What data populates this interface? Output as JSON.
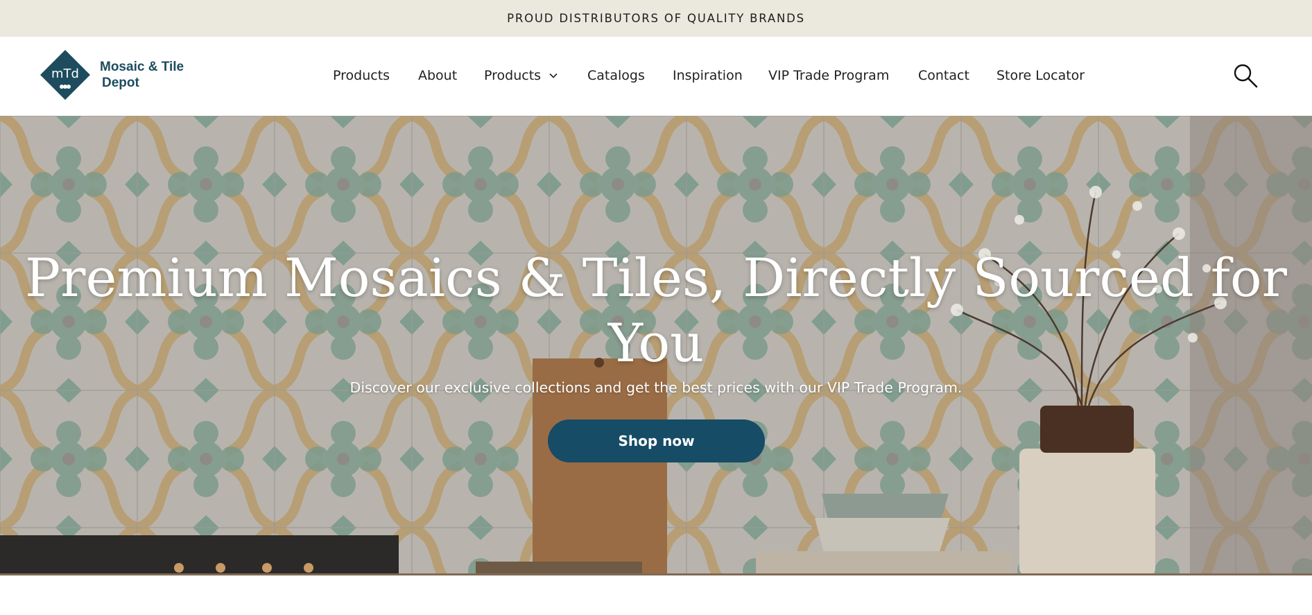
{
  "announcement": {
    "text": "PROUD DISTRIBUTORS OF QUALITY BRANDS"
  },
  "brand": {
    "name_line1": "Mosaic & Tile",
    "name_line2": "Depot",
    "mark_letters": "mTd",
    "color": "#1d4c5e"
  },
  "nav": {
    "items": [
      {
        "label": "Products"
      },
      {
        "label": "About"
      },
      {
        "label": "Products",
        "icon": "chevron-down-icon"
      },
      {
        "label": "Catalogs"
      },
      {
        "label": "Inspiration"
      },
      {
        "label": "VIP Trade Program"
      },
      {
        "label": "Contact"
      },
      {
        "label": "Store Locator"
      }
    ],
    "search_icon": "search-icon"
  },
  "hero": {
    "title": "Premium Mosaics & Tiles, Directly Sourced for You",
    "subtitle": "Discover our exclusive collections and get the best prices with our VIP Trade Program.",
    "cta_label": "Shop now",
    "cta_color": "#164c66"
  },
  "colors": {
    "announcement_bg": "#ebe8de",
    "header_bg": "#ffffff"
  }
}
